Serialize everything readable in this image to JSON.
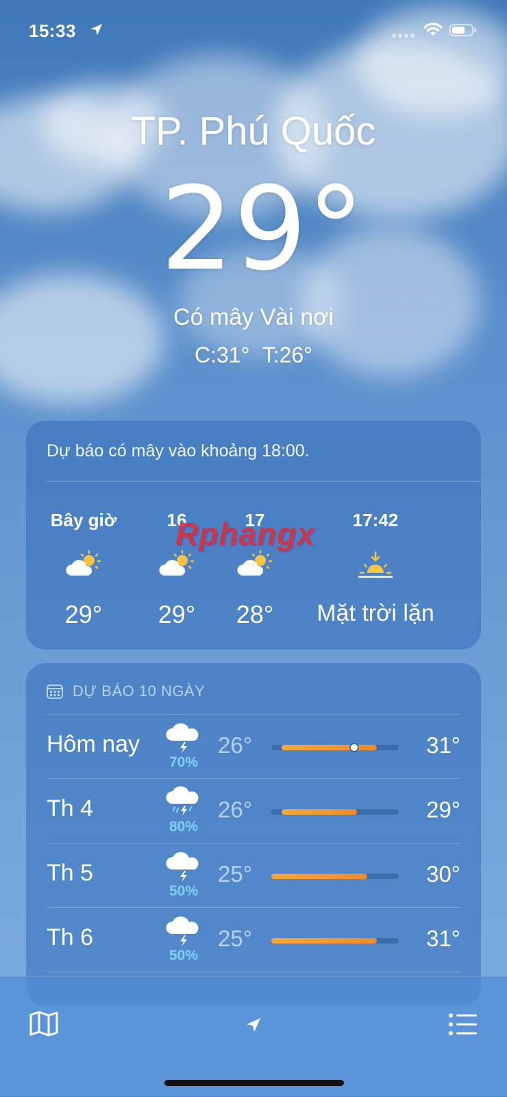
{
  "status_bar": {
    "time": "15:33"
  },
  "header": {
    "city": "TP. Phú Quốc",
    "temperature": "29°",
    "condition": "Có mây Vài nơi",
    "high_low": "C:31°  T:26°"
  },
  "hourly": {
    "summary": "Dự báo có mây vào khoảng 18:00.",
    "items": [
      {
        "label": "Bây giờ",
        "icon": "partly-cloudy-icon",
        "value": "29°"
      },
      {
        "label": "16",
        "icon": "partly-cloudy-icon",
        "value": "29°"
      },
      {
        "label": "17",
        "icon": "partly-cloudy-icon",
        "value": "28°"
      },
      {
        "label": "17:42",
        "icon": "sunset-icon",
        "value": "Mặt trời lặn"
      }
    ]
  },
  "watermark": "Rphangx",
  "daily": {
    "title": "DỰ BÁO 10 NGÀY",
    "rows": [
      {
        "day": "Hôm nay",
        "icon": "thunderstorm-icon",
        "precip": "70%",
        "low": "26°",
        "high": "31°",
        "range_start": 0.08,
        "range_end": 0.83,
        "current": 0.65
      },
      {
        "day": "Th 4",
        "icon": "thunderstorm-rain-icon",
        "precip": "80%",
        "low": "26°",
        "high": "29°",
        "range_start": 0.08,
        "range_end": 0.67
      },
      {
        "day": "Th 5",
        "icon": "thunderstorm-icon",
        "precip": "50%",
        "low": "25°",
        "high": "30°",
        "range_start": 0.0,
        "range_end": 0.75
      },
      {
        "day": "Th 6",
        "icon": "thunderstorm-icon",
        "precip": "50%",
        "low": "25°",
        "high": "31°",
        "range_start": 0.0,
        "range_end": 0.83
      }
    ]
  },
  "tab_bar": {
    "left_icon": "map-icon",
    "center_icon": "location-arrow-icon",
    "right_icon": "list-icon"
  }
}
